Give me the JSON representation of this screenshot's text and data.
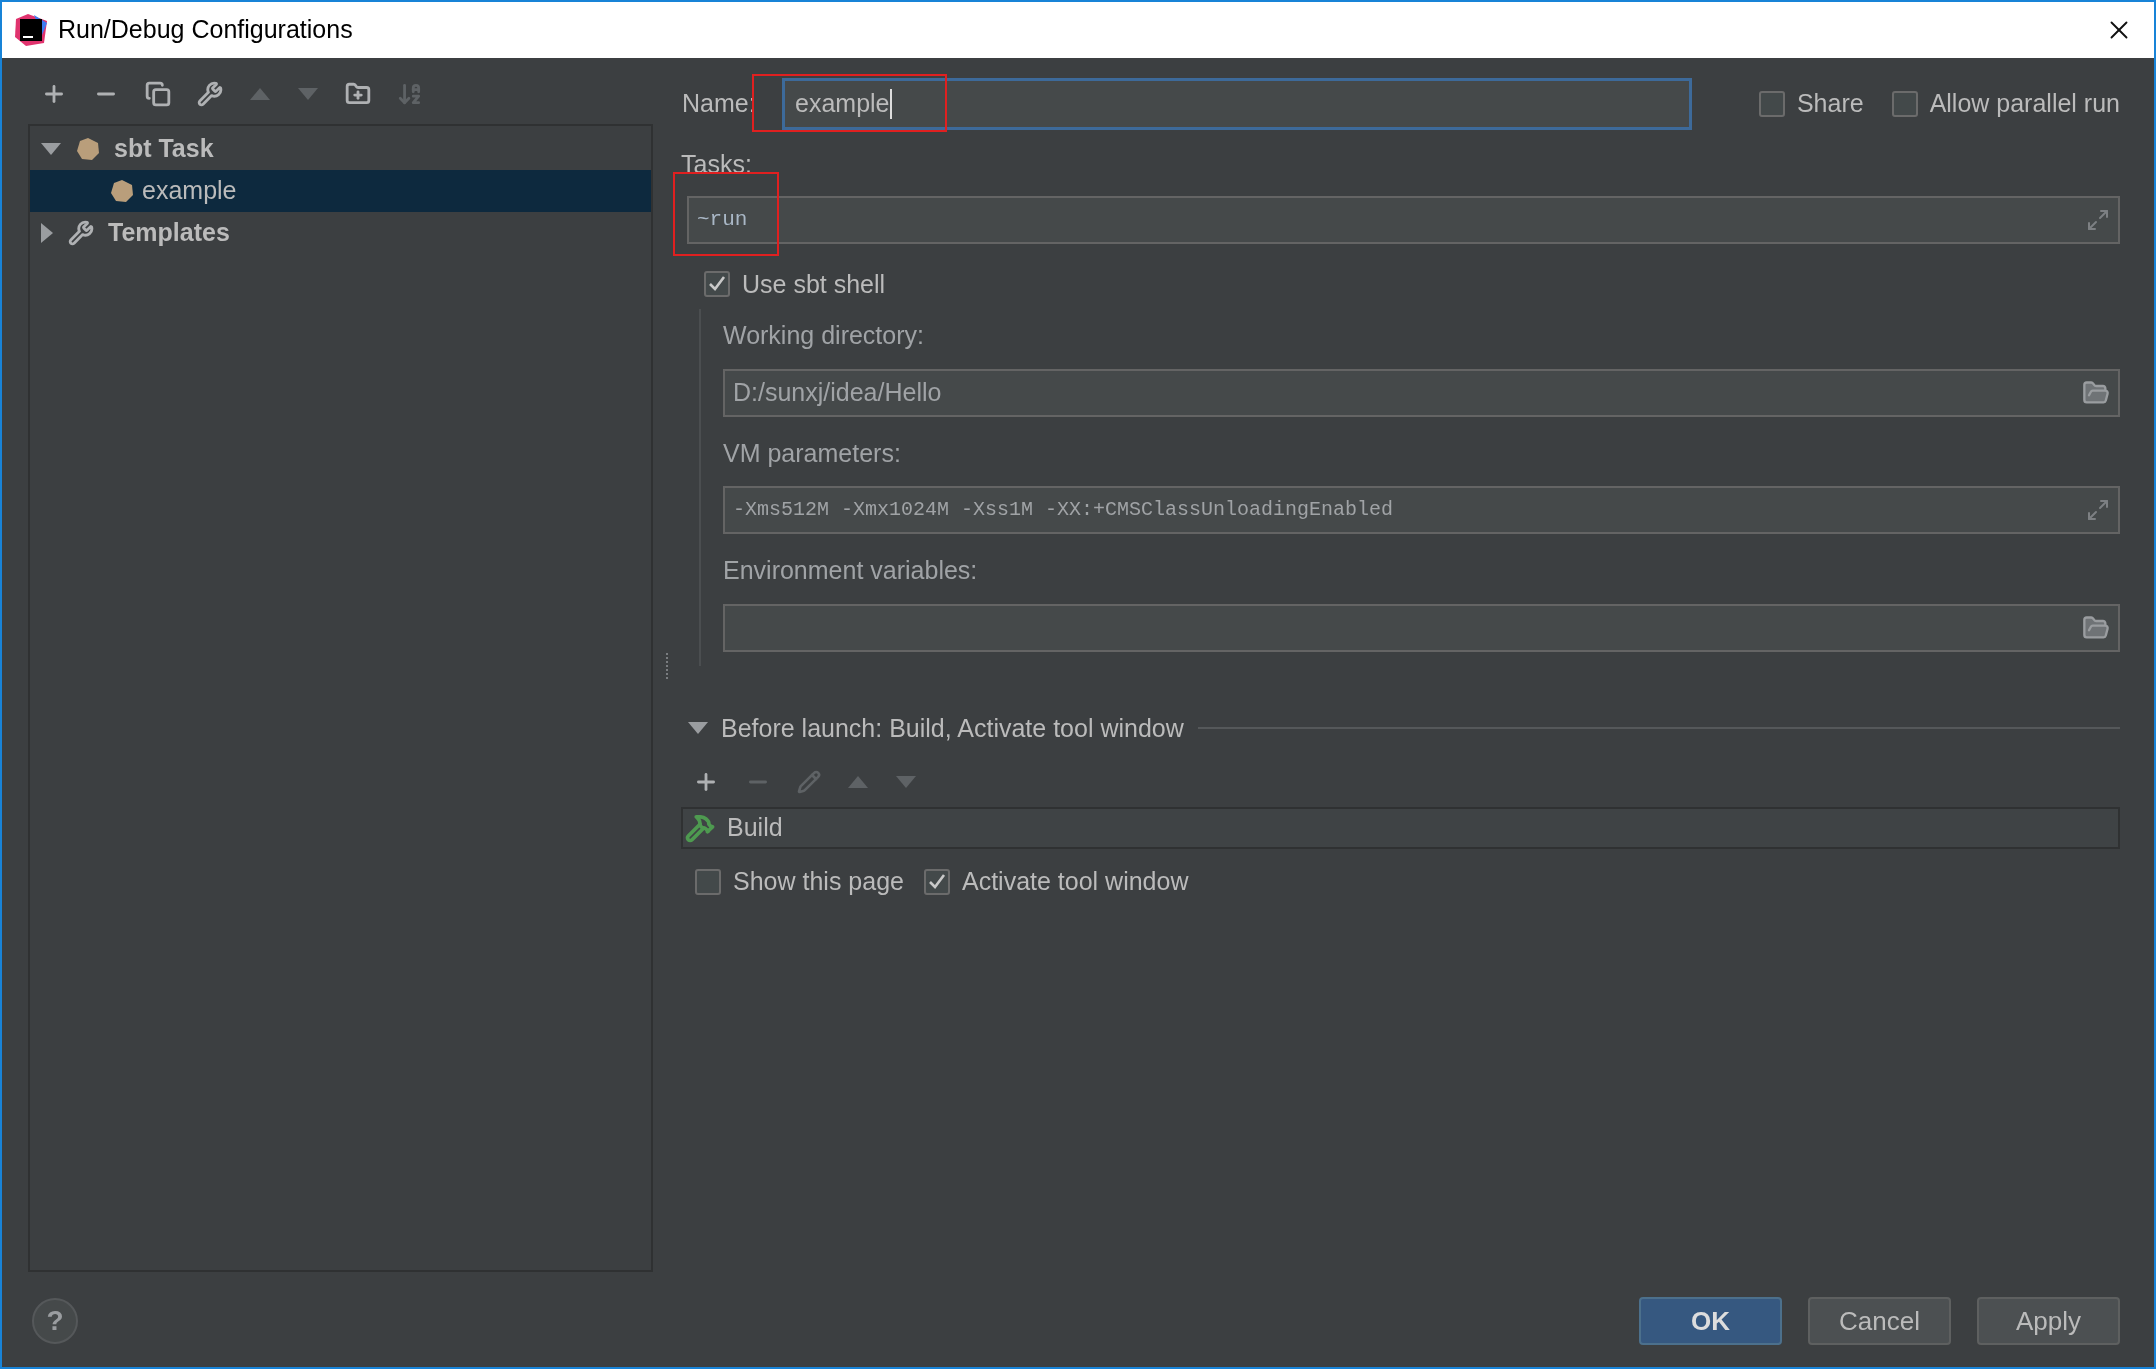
{
  "window": {
    "title": "Run/Debug Configurations"
  },
  "toolbar": [
    {
      "kind": "add",
      "disabled": false
    },
    {
      "kind": "remove",
      "disabled": false
    },
    {
      "kind": "copy",
      "disabled": false
    },
    {
      "kind": "edit-defaults",
      "disabled": false
    },
    {
      "kind": "up",
      "disabled": true
    },
    {
      "kind": "down",
      "disabled": true
    },
    {
      "kind": "folder",
      "disabled": false
    },
    {
      "kind": "sort",
      "disabled": true
    }
  ],
  "tree": [
    {
      "label": "sbt Task",
      "kind": "sbt",
      "expanded": true,
      "selected": false,
      "children": [
        {
          "label": "example",
          "kind": "sbt",
          "selected": true
        }
      ]
    },
    {
      "label": "Templates",
      "kind": "templates",
      "expanded": false,
      "selected": false
    }
  ],
  "name": {
    "label": "Name:",
    "value": "example",
    "focused": true
  },
  "options": [
    {
      "label": "Share",
      "checked": false
    },
    {
      "label": "Allow parallel run",
      "checked": false
    }
  ],
  "tasks": {
    "label": "Tasks:",
    "value": "~run",
    "kind": "expand"
  },
  "use_sbt_shell": {
    "label": "Use sbt shell",
    "checked": true
  },
  "fields": [
    {
      "label": "Working directory:",
      "value": "D:/sunxj/idea/Hello",
      "mono": false,
      "kind": "folder"
    },
    {
      "label": "VM parameters:",
      "value": "-Xms512M -Xmx1024M -Xss1M -XX:+CMSClassUnloadingEnabled",
      "mono": true,
      "kind": "expand"
    },
    {
      "label": "Environment variables:",
      "kind": "folder"
    }
  ],
  "before_launch": {
    "title": "Before launch: Build, Activate tool window",
    "expanded": true,
    "toolbar": [
      {
        "kind": "add",
        "disabled": false
      },
      {
        "kind": "remove",
        "disabled": true
      },
      {
        "kind": "edit",
        "disabled": true
      },
      {
        "kind": "up",
        "disabled": true
      },
      {
        "kind": "down",
        "disabled": true
      }
    ],
    "items": [
      {
        "label": "Build"
      }
    ],
    "checkboxes": [
      {
        "label": "Show this page",
        "checked": false
      },
      {
        "label": "Activate tool window",
        "checked": true
      }
    ]
  },
  "help": {
    "label": "?"
  },
  "buttons": [
    {
      "label": "OK",
      "default": true
    },
    {
      "label": "Cancel",
      "default": false
    },
    {
      "label": "Apply",
      "default": false
    }
  ]
}
